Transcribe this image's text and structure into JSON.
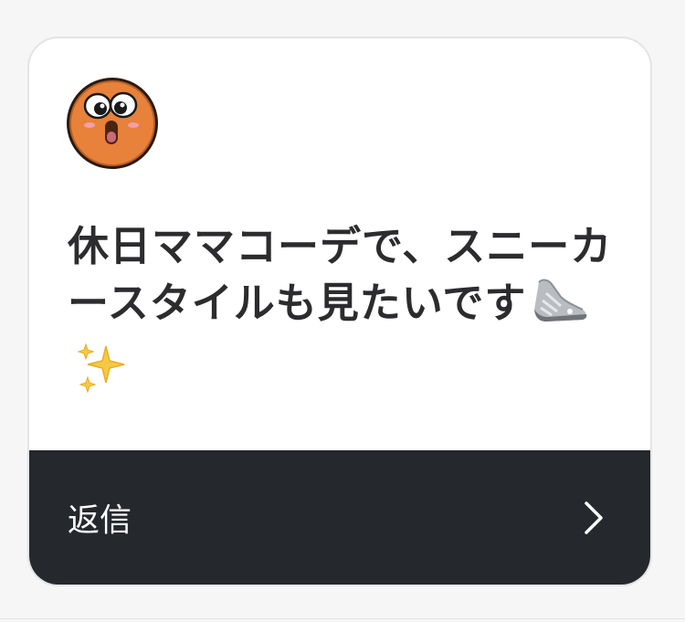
{
  "card": {
    "message": "休日ママコーデで、スニーカースタイルも見たいです",
    "emoji_1": "sneaker-emoji",
    "emoji_2": "sparkles-emoji",
    "avatar_icon": "surprised-face-avatar"
  },
  "reply": {
    "label": "返信",
    "icon": "chevron-right-icon"
  },
  "colors": {
    "reply_bar": "#25282d",
    "text": "#2c2c2e",
    "avatar_orange": "#e8813a"
  }
}
